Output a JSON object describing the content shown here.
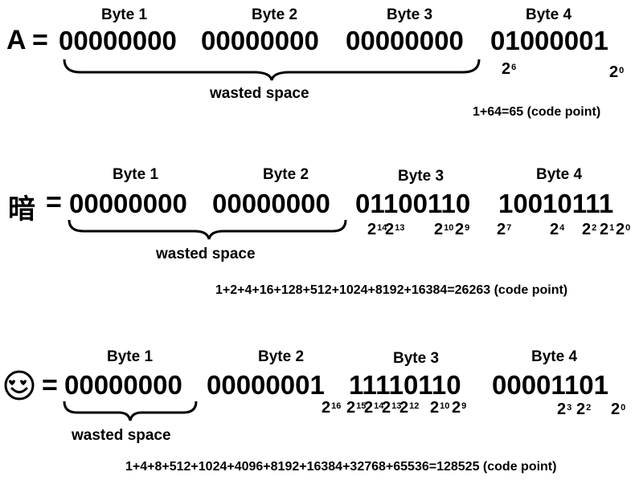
{
  "rows": [
    {
      "character": "A",
      "equals": "=",
      "bytes": [
        {
          "label": "Byte 1",
          "bits": "00000000"
        },
        {
          "label": "Byte 2",
          "bits": "00000000"
        },
        {
          "label": "Byte 3",
          "bits": "00000000"
        },
        {
          "label": "Byte 4",
          "bits": "01000001"
        }
      ],
      "wasted_label": "wasted space",
      "powers": [
        {
          "base": "2",
          "exp": "6"
        },
        {
          "base": "2",
          "exp": "0"
        }
      ],
      "sum_text": "1+64=65 (code point)"
    },
    {
      "character": "暗",
      "equals": "=",
      "bytes": [
        {
          "label": "Byte 1",
          "bits": "00000000"
        },
        {
          "label": "Byte 2",
          "bits": "00000000"
        },
        {
          "label": "Byte 3",
          "bits": "01100110"
        },
        {
          "label": "Byte 4",
          "bits": "10010111"
        }
      ],
      "wasted_label": "wasted space",
      "powers": [
        {
          "base": "2",
          "exp": "14"
        },
        {
          "base": "2",
          "exp": "13"
        },
        {
          "base": "2",
          "exp": "10"
        },
        {
          "base": "2",
          "exp": "9"
        },
        {
          "base": "2",
          "exp": "7"
        },
        {
          "base": "2",
          "exp": "4"
        },
        {
          "base": "2",
          "exp": "2"
        },
        {
          "base": "2",
          "exp": "1"
        },
        {
          "base": "2",
          "exp": "0"
        }
      ],
      "sum_text": "1+2+4+16+128+512+1024+8192+16384=26263 (code point)"
    },
    {
      "character_icon": "smiling-face-with-heart-eyes-icon",
      "equals": "=",
      "bytes": [
        {
          "label": "Byte 1",
          "bits": "00000000"
        },
        {
          "label": "Byte 2",
          "bits": "00000001"
        },
        {
          "label": "Byte 3",
          "bits": "11110110"
        },
        {
          "label": "Byte 4",
          "bits": "00001101"
        }
      ],
      "wasted_label": "wasted space",
      "powers": [
        {
          "base": "2",
          "exp": "16"
        },
        {
          "base": "2",
          "exp": "15"
        },
        {
          "base": "2",
          "exp": "14"
        },
        {
          "base": "2",
          "exp": "13"
        },
        {
          "base": "2",
          "exp": "12"
        },
        {
          "base": "2",
          "exp": "10"
        },
        {
          "base": "2",
          "exp": "9"
        },
        {
          "base": "2",
          "exp": "3"
        },
        {
          "base": "2",
          "exp": "2"
        },
        {
          "base": "2",
          "exp": "0"
        }
      ],
      "sum_text": "1+4+8+512+1024+4096+8192+16384+32768+65536=128525 (code point)"
    }
  ]
}
